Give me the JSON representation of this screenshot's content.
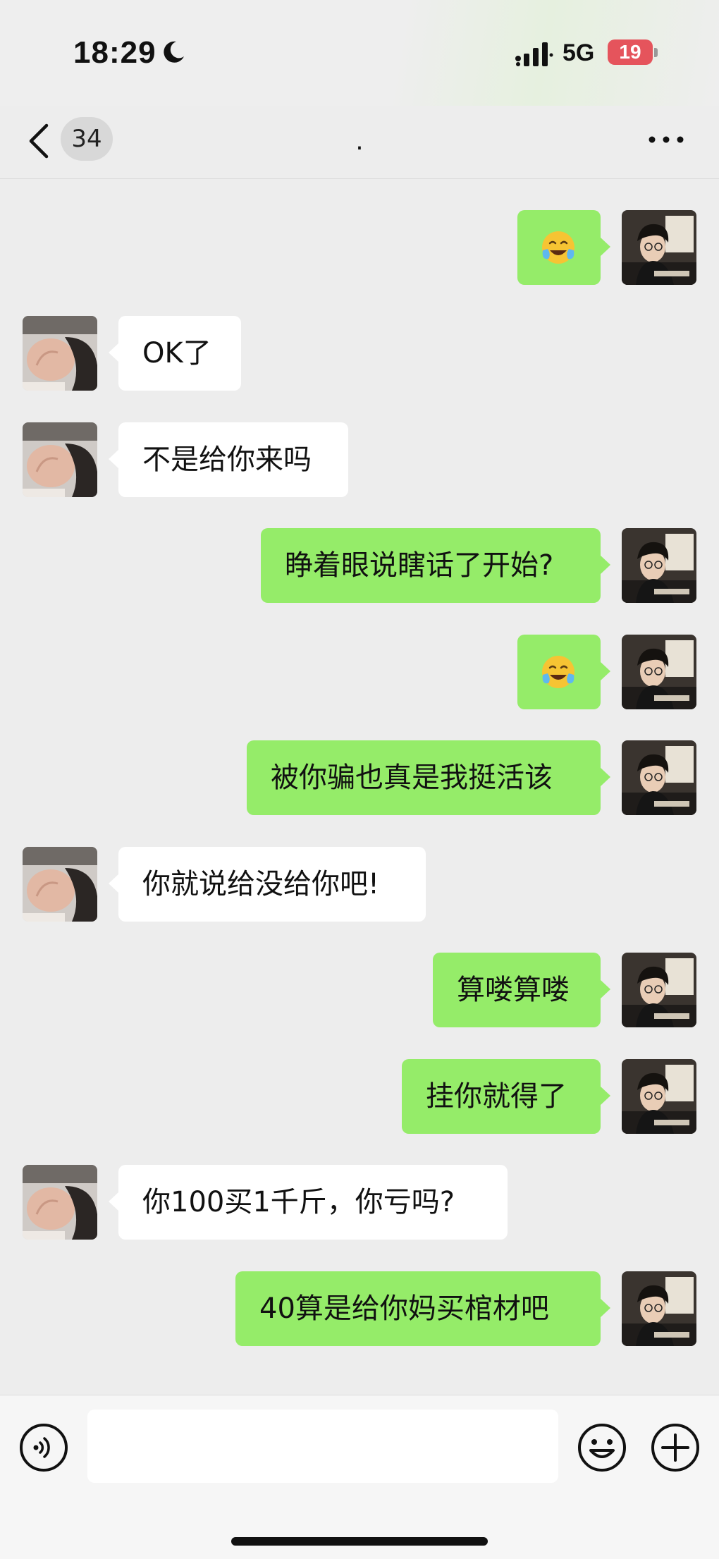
{
  "status_bar": {
    "time": "18:29",
    "network": "5G",
    "battery": "19",
    "icons": [
      "moon-icon",
      "signal-icon",
      "battery-charging-icon"
    ]
  },
  "nav": {
    "unread_count": "34",
    "title": ".",
    "icons": [
      "back-icon",
      "more-icon"
    ]
  },
  "messages": [
    {
      "side": "right",
      "type": "text",
      "text": ""
    },
    {
      "side": "right",
      "type": "emoji",
      "emoji": "crying-laughing-emoji"
    },
    {
      "side": "left",
      "type": "text",
      "text": "OK了"
    },
    {
      "side": "left",
      "type": "text",
      "text": "不是给你来吗"
    },
    {
      "side": "right",
      "type": "text",
      "text": "睁着眼说瞎话了开始?"
    },
    {
      "side": "right",
      "type": "emoji",
      "emoji": "crying-laughing-emoji"
    },
    {
      "side": "right",
      "type": "text",
      "text": "被你骗也真是我挺活该"
    },
    {
      "side": "left",
      "type": "text",
      "text": "你就说给没给你吧!"
    },
    {
      "side": "right",
      "type": "text",
      "text": "算喽算喽"
    },
    {
      "side": "right",
      "type": "text",
      "text": "挂你就得了"
    },
    {
      "side": "left",
      "type": "text",
      "text": "你100买1千斤，你亏吗?"
    },
    {
      "side": "right",
      "type": "text",
      "text": "40算是给你妈买棺材吧"
    }
  ],
  "input_bar": {
    "input_value": "",
    "icons": [
      "voice-icon",
      "emoji-icon",
      "plus-icon"
    ]
  },
  "colors": {
    "background": "#ededed",
    "self_bubble": "#95ec69",
    "other_bubble": "#ffffff",
    "battery_low": "#e5545c"
  }
}
